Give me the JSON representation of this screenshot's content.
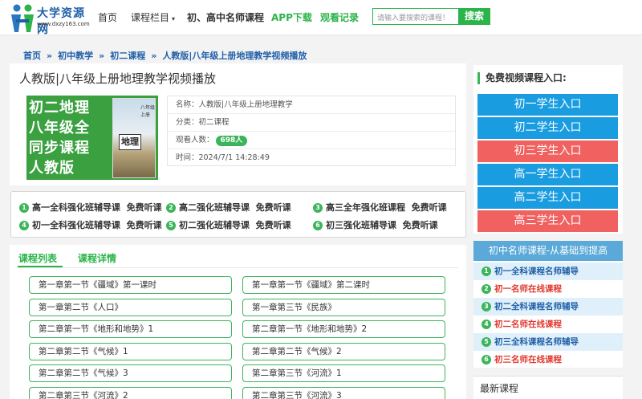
{
  "site": {
    "title": "大学资源网",
    "url": "www.dxzy163.com"
  },
  "nav": {
    "items": [
      {
        "label": "首页"
      },
      {
        "label": "课程栏目"
      },
      {
        "label": "初、高中名师课程"
      },
      {
        "label": "APP下载"
      },
      {
        "label": "观看记录"
      }
    ],
    "search_placeholder": "请输入要搜索的课程！",
    "search_button": "搜索"
  },
  "breadcrumb": [
    "首页",
    "初中教学",
    "初二课程",
    "人教版|八年级上册地理教学视频播放"
  ],
  "breadcrumb_sep": "»",
  "course": {
    "title": "人教版|八年级上册地理教学视频播放",
    "cover_lines": [
      "初二地理",
      "八年级全",
      "同步课程",
      "人教版"
    ],
    "book_grade": "八年级",
    "book_volume": "上册",
    "book_subject": "地理",
    "name_label": "名称：",
    "name": "人教版|八年级上册地理教学",
    "category_label": "分类：",
    "category": "初二课程",
    "views_label": "观看人数：",
    "views": "698人",
    "time_label": "时间：",
    "time": "2024/7/1 14:28:49"
  },
  "classes": [
    {
      "num": "1",
      "name": "高一全科强化班辅导课",
      "tag": "免费听课"
    },
    {
      "num": "2",
      "name": "高二强化班辅导课",
      "tag": "免费听课"
    },
    {
      "num": "3",
      "name": "高三全年强化班课程",
      "tag": "免费听课"
    },
    {
      "num": "4",
      "name": "初一全科强化班辅导课",
      "tag": "免费听课"
    },
    {
      "num": "5",
      "name": "初二强化班辅导课",
      "tag": "免费听课"
    },
    {
      "num": "6",
      "name": "初三强化班辅导课",
      "tag": "免费听课"
    }
  ],
  "tabs": [
    {
      "label": "课程列表"
    },
    {
      "label": "课程详情"
    }
  ],
  "chapters": [
    "第一章第一节《疆域》第一课时",
    "第一章第一节《疆域》第二课时",
    "第一章第二节《人口》",
    "第一章第三节《民族》",
    "第二章第一节《地形和地势》1",
    "第二章第一节《地形和地势》2",
    "第二章第二节《气候》1",
    "第二章第二节《气候》2",
    "第二章第二节《气候》3",
    "第二章第三节《河流》1",
    "第二章第三节《河流》2",
    "第二章第三节《河流》3"
  ],
  "sidebar": {
    "free_title": "免费视频课程入口:",
    "entries": [
      {
        "label": "初一学生入口",
        "color": "#1a9ce0"
      },
      {
        "label": "初二学生入口",
        "color": "#1a9ce0"
      },
      {
        "label": "初三学生入口",
        "color": "#f0615f"
      },
      {
        "label": "高一学生入口",
        "color": "#1a9ce0"
      },
      {
        "label": "高二学生入口",
        "color": "#1a9ce0"
      },
      {
        "label": "高三学生入口",
        "color": "#f0615f"
      }
    ],
    "teachers_title": "初中名师课程-从基础到提高",
    "teachers": [
      {
        "num": "1",
        "label": "初一全科课程名师辅导",
        "color": "#1f5fa8"
      },
      {
        "num": "2",
        "label": "初一名师在线课程",
        "color": "#e03a2f"
      },
      {
        "num": "3",
        "label": "初二全科课程名师辅导",
        "color": "#1f5fa8"
      },
      {
        "num": "4",
        "label": "初二名师在线课程",
        "color": "#e03a2f"
      },
      {
        "num": "5",
        "label": "初三全科课程名师辅导",
        "color": "#1f5fa8"
      },
      {
        "num": "6",
        "label": "初三名师在线课程",
        "color": "#e03a2f"
      }
    ],
    "latest_title": "最新课程"
  },
  "colors": {
    "accent": "#2bb44a",
    "link_blue": "#1f5fa8",
    "entry_blue": "#1a9ce0",
    "entry_red": "#f0615f"
  }
}
